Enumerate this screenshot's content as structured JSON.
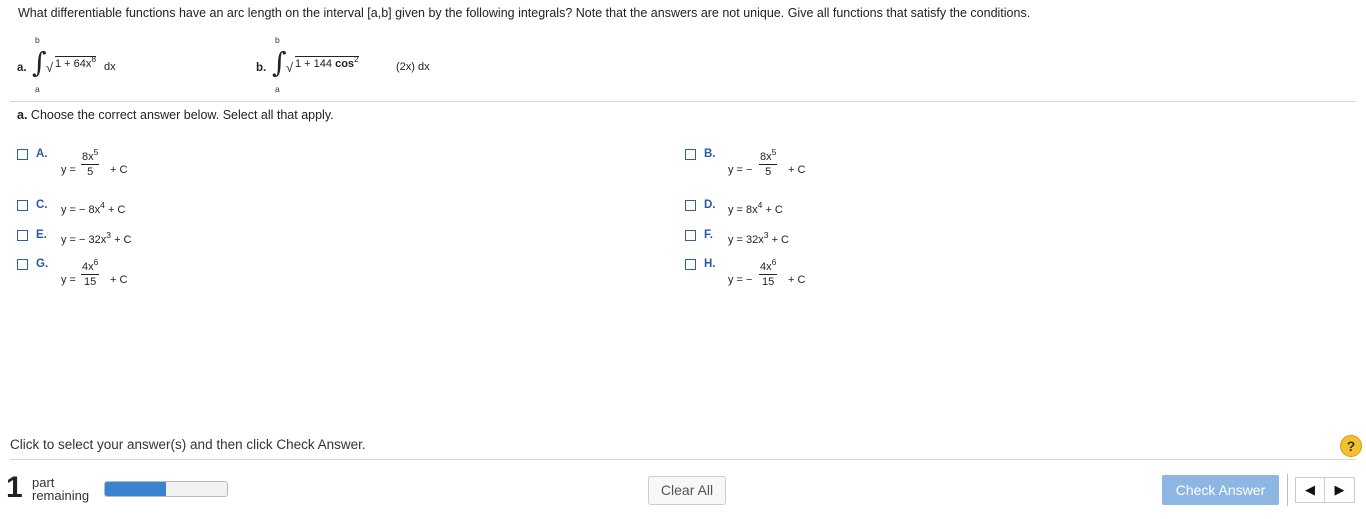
{
  "question": "What differentiable functions have an arc length on the interval [a,b] given by the following integrals? Note that the answers are not unique. Give all functions that satisfy the conditions.",
  "integral_a": {
    "label": "a.",
    "upper": "b",
    "lower": "a",
    "integrand_base": "1 + 64x",
    "exp": "8",
    "tail": "dx"
  },
  "integral_b": {
    "label": "b.",
    "upper": "b",
    "lower": "a",
    "integrand_pre": "1 + 144",
    "cos": "cos",
    "exp": "2",
    "tail": "(2x) dx"
  },
  "prompt": {
    "label": "a.",
    "text": "Choose the correct answer below. Select all that apply."
  },
  "options": {
    "A": {
      "label": "A.",
      "lhs": "y =",
      "num": "8x",
      "num_exp": "5",
      "den": "5",
      "rhs": "+ C"
    },
    "B": {
      "label": "B.",
      "lhs": "y = −",
      "num": "8x",
      "num_exp": "5",
      "den": "5",
      "rhs": "+ C"
    },
    "C": {
      "label": "C.",
      "expr": "y = − 8x",
      "exp": "4",
      "rhs": "+ C"
    },
    "D": {
      "label": "D.",
      "expr": "y = 8x",
      "exp": "4",
      "rhs": "+ C"
    },
    "E": {
      "label": "E.",
      "expr": "y = − 32x",
      "exp": "3",
      "rhs": "+ C"
    },
    "F": {
      "label": "F.",
      "expr": "y = 32x",
      "exp": "3",
      "rhs": "+ C"
    },
    "G": {
      "label": "G.",
      "lhs": "y =",
      "num": "4x",
      "num_exp": "6",
      "den": "15",
      "rhs": "+ C"
    },
    "H": {
      "label": "H.",
      "lhs": "y = −",
      "num": "4x",
      "num_exp": "6",
      "den": "15",
      "rhs": "+ C"
    }
  },
  "footer": {
    "instruction": "Click to select your answer(s) and then click Check Answer.",
    "help_label": "?",
    "parts_count": "1",
    "parts_word": "part",
    "remaining_word": "remaining",
    "progress_fraction": 0.5,
    "clear_label": "Clear All",
    "check_label": "Check Answer",
    "prev_glyph": "◀",
    "next_glyph": "▶"
  },
  "colors": {
    "accent": "#2a5aa6",
    "check_button": "#8db6e3",
    "progress_fill": "#3b82cf",
    "help": "#f2c12e"
  }
}
